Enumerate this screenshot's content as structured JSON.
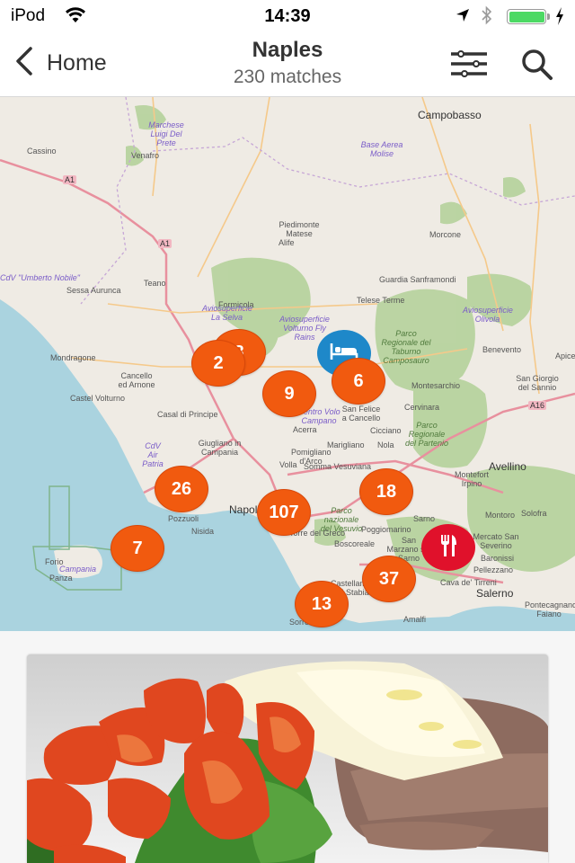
{
  "status_bar": {
    "carrier": "iPod",
    "time": "14:39",
    "battery_level": 1.0,
    "charging": true,
    "icons": [
      "wifi-icon",
      "location-arrow-icon",
      "bluetooth-icon",
      "battery-icon",
      "charging-bolt-icon"
    ]
  },
  "nav": {
    "back_label": "Home",
    "title": "Naples",
    "subtitle": "230 matches",
    "actions": [
      "filter-sliders-icon",
      "search-icon"
    ]
  },
  "colors": {
    "cluster": "#f15a0f",
    "hotel_marker": "#1e88c9",
    "restaurant_marker": "#e0112b",
    "battery": "#4cd964"
  },
  "map": {
    "clusters": [
      {
        "id": "c-hidden",
        "count": "8"
      },
      {
        "id": "c-2",
        "count": "2"
      },
      {
        "id": "c-9",
        "count": "9"
      },
      {
        "id": "c-6",
        "count": "6"
      },
      {
        "id": "c-26",
        "count": "26"
      },
      {
        "id": "c-18",
        "count": "18"
      },
      {
        "id": "c-107",
        "count": "107"
      },
      {
        "id": "c-7",
        "count": "7"
      },
      {
        "id": "c-37",
        "count": "37"
      },
      {
        "id": "c-13",
        "count": "13"
      }
    ],
    "pois": [
      {
        "type": "hotel",
        "icon": "bed-icon"
      },
      {
        "type": "restaurant",
        "icon": "fork-knife-icon"
      }
    ],
    "labels": {
      "campobasso": "Campobasso",
      "cassino": "Cassino",
      "venafro": "Venafro",
      "marchese": "Marchese Luigi Del Prete",
      "base_aerea": "Base Aerea Molise",
      "piedimonte": "Piedimonte Matese",
      "alife": "Alife",
      "morcone": "Morcone",
      "guardia": "Guardia Sanframondi",
      "telese": "Telese Terme",
      "teano": "Teano",
      "sessa": "Sessa Aurunca",
      "formicola": "Formicola",
      "cdv": "CdV \"Umberto Nobile\"",
      "mondragone": "Mondragone",
      "cancello": "Cancello ed Arnone",
      "castel_volturno": "Castel Volturno",
      "casal": "Casal di Principe",
      "benevento": "Benevento",
      "apice": "Apice",
      "san_giorgio": "San Giorgio del Sannio",
      "montesarchio": "Montesarchio",
      "cervinara": "Cervinara",
      "parco_taburno": "Parco Regionale del Taburno Camposauro",
      "parco_partenio": "Parco Regionale del Partenio",
      "avellino": "Avellino",
      "montefort": "Montefort Irpino",
      "montoro": "Montoro",
      "solofra": "Solofra",
      "mercato": "Mercato San Severino",
      "baronissi": "Baronissi",
      "pellezzano": "Pellezzano",
      "cava": "Cava de' Tirreni",
      "salerno": "Salerno",
      "pontecagnano": "Pontecagnano Faiano",
      "san_felice": "San Felice a Cancello",
      "acerra": "Acerra",
      "napoli": "Napoli",
      "pozzuoli": "Pozzuoli",
      "nisida": "Nisida",
      "giugliano": "Giugliano in Campania",
      "marigliano": "Marigliano",
      "nola": "Nola",
      "cicciano": "Cicciano",
      "pomigliano": "Pomigliano d'Arco",
      "volla": "Volla",
      "somma": "Somma Vesuviana",
      "parco_vesuvio": "Parco nazionale del Vesuvio",
      "torre": "Torre del Greco",
      "boscoreale": "Boscoreale",
      "poggiomarino": "Poggiomarino",
      "sarno": "Sarno",
      "san_marzano": "San Marzano sul Sarno",
      "castellammare": "Castellammare di Stabia",
      "amalfi": "Amalfi",
      "sorrento": "Sorre",
      "forio": "Forio",
      "panza": "Panza",
      "campania": "Campania",
      "aviosuperficie_selva": "Aviosuperficie La Selva",
      "aviosuperficie_volturno": "Aviosuperficie Volturno Fly Rains",
      "aviosuperficie_olivola": "Aviosuperficie Olivola",
      "centro_volo": "Centro Volo Campano",
      "cdv_patria": "CdV Air Patria",
      "a1": "A1",
      "a16": "A16"
    }
  },
  "listing": {
    "photo_alt": "Grilled steak with parmesan shavings, cherry tomatoes and arugula"
  }
}
